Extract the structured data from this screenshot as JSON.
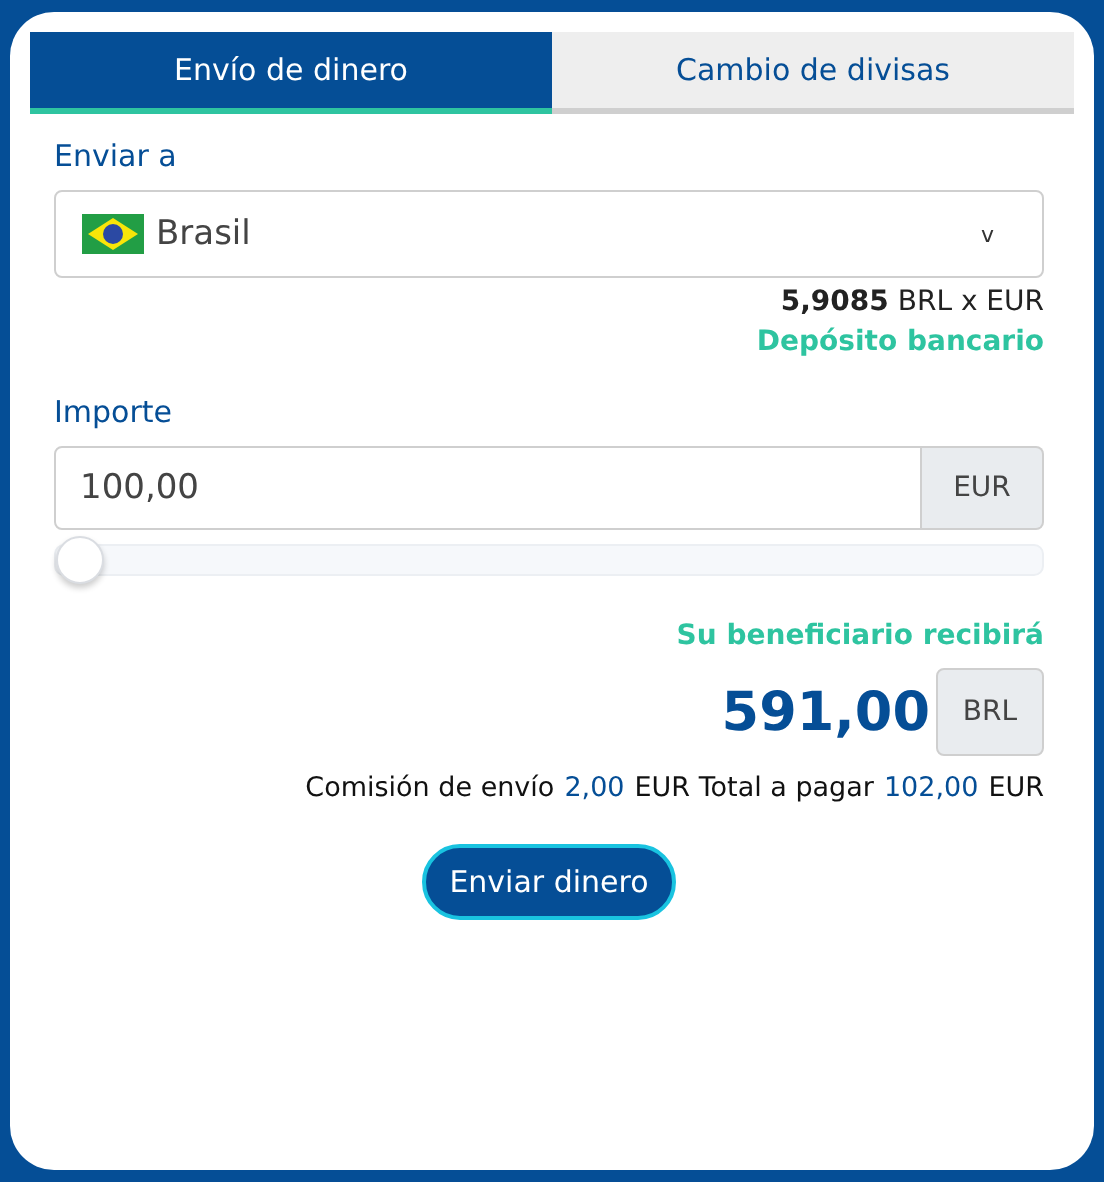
{
  "tabs": [
    {
      "label": "Envío de dinero",
      "selected": true
    },
    {
      "label": "Cambio de divisas",
      "selected": false
    }
  ],
  "destination": {
    "label": "Enviar a",
    "value": "Brasil",
    "caret": "v"
  },
  "rate": "**5,9085** BRL x EUR",
  "method": "Depósito bancario",
  "amount": {
    "label": "Importe",
    "value": "100,00",
    "currency": "EUR",
    "level": 0
  },
  "receive": {
    "label": "Su beneficiario recibirá",
    "value": "591,00",
    "currency": "BRL"
  },
  "fee": [
    {
      "text": "Comisión de envío",
      "highlight": false
    },
    {
      "text": "2,00",
      "highlight": true
    },
    {
      "text": "EUR Total a pagar",
      "highlight": false
    },
    {
      "text": "102,00",
      "highlight": true
    },
    {
      "text": "EUR",
      "highlight": false
    }
  ],
  "submit": "Enviar dinero"
}
